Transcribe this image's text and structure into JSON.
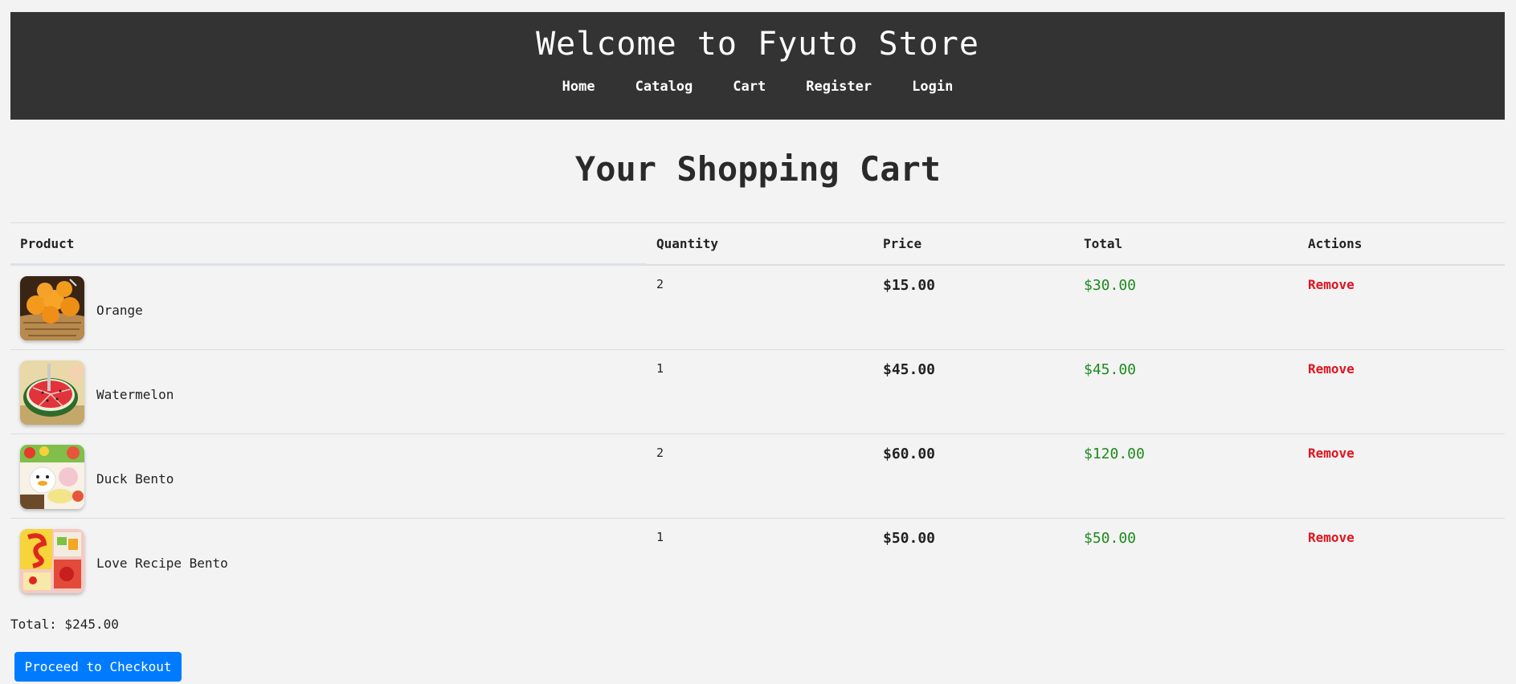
{
  "header": {
    "title": "Welcome to Fyuto Store",
    "nav": [
      {
        "label": "Home"
      },
      {
        "label": "Catalog"
      },
      {
        "label": "Cart"
      },
      {
        "label": "Register"
      },
      {
        "label": "Login"
      }
    ]
  },
  "page_title": "Your Shopping Cart",
  "table": {
    "columns": [
      "Product",
      "Quantity",
      "Price",
      "Total",
      "Actions"
    ],
    "rows": [
      {
        "name": "Orange",
        "quantity": "2",
        "price": "$15.00",
        "total": "$30.00",
        "action": "Remove",
        "icon": "orange-basket-image"
      },
      {
        "name": "Watermelon",
        "quantity": "1",
        "price": "$45.00",
        "total": "$45.00",
        "action": "Remove",
        "icon": "watermelon-image"
      },
      {
        "name": "Duck Bento",
        "quantity": "2",
        "price": "$60.00",
        "total": "$120.00",
        "action": "Remove",
        "icon": "duck-bento-image"
      },
      {
        "name": "Love Recipe Bento",
        "quantity": "1",
        "price": "$50.00",
        "total": "$50.00",
        "action": "Remove",
        "icon": "love-bento-image"
      }
    ]
  },
  "summary": {
    "total_text": "Total: $245.00"
  },
  "checkout_label": "Proceed to Checkout",
  "colors": {
    "header_bg": "#333333",
    "row_total": "#1d8a1d",
    "remove": "#e0141e",
    "checkout_button": "#007bff"
  }
}
